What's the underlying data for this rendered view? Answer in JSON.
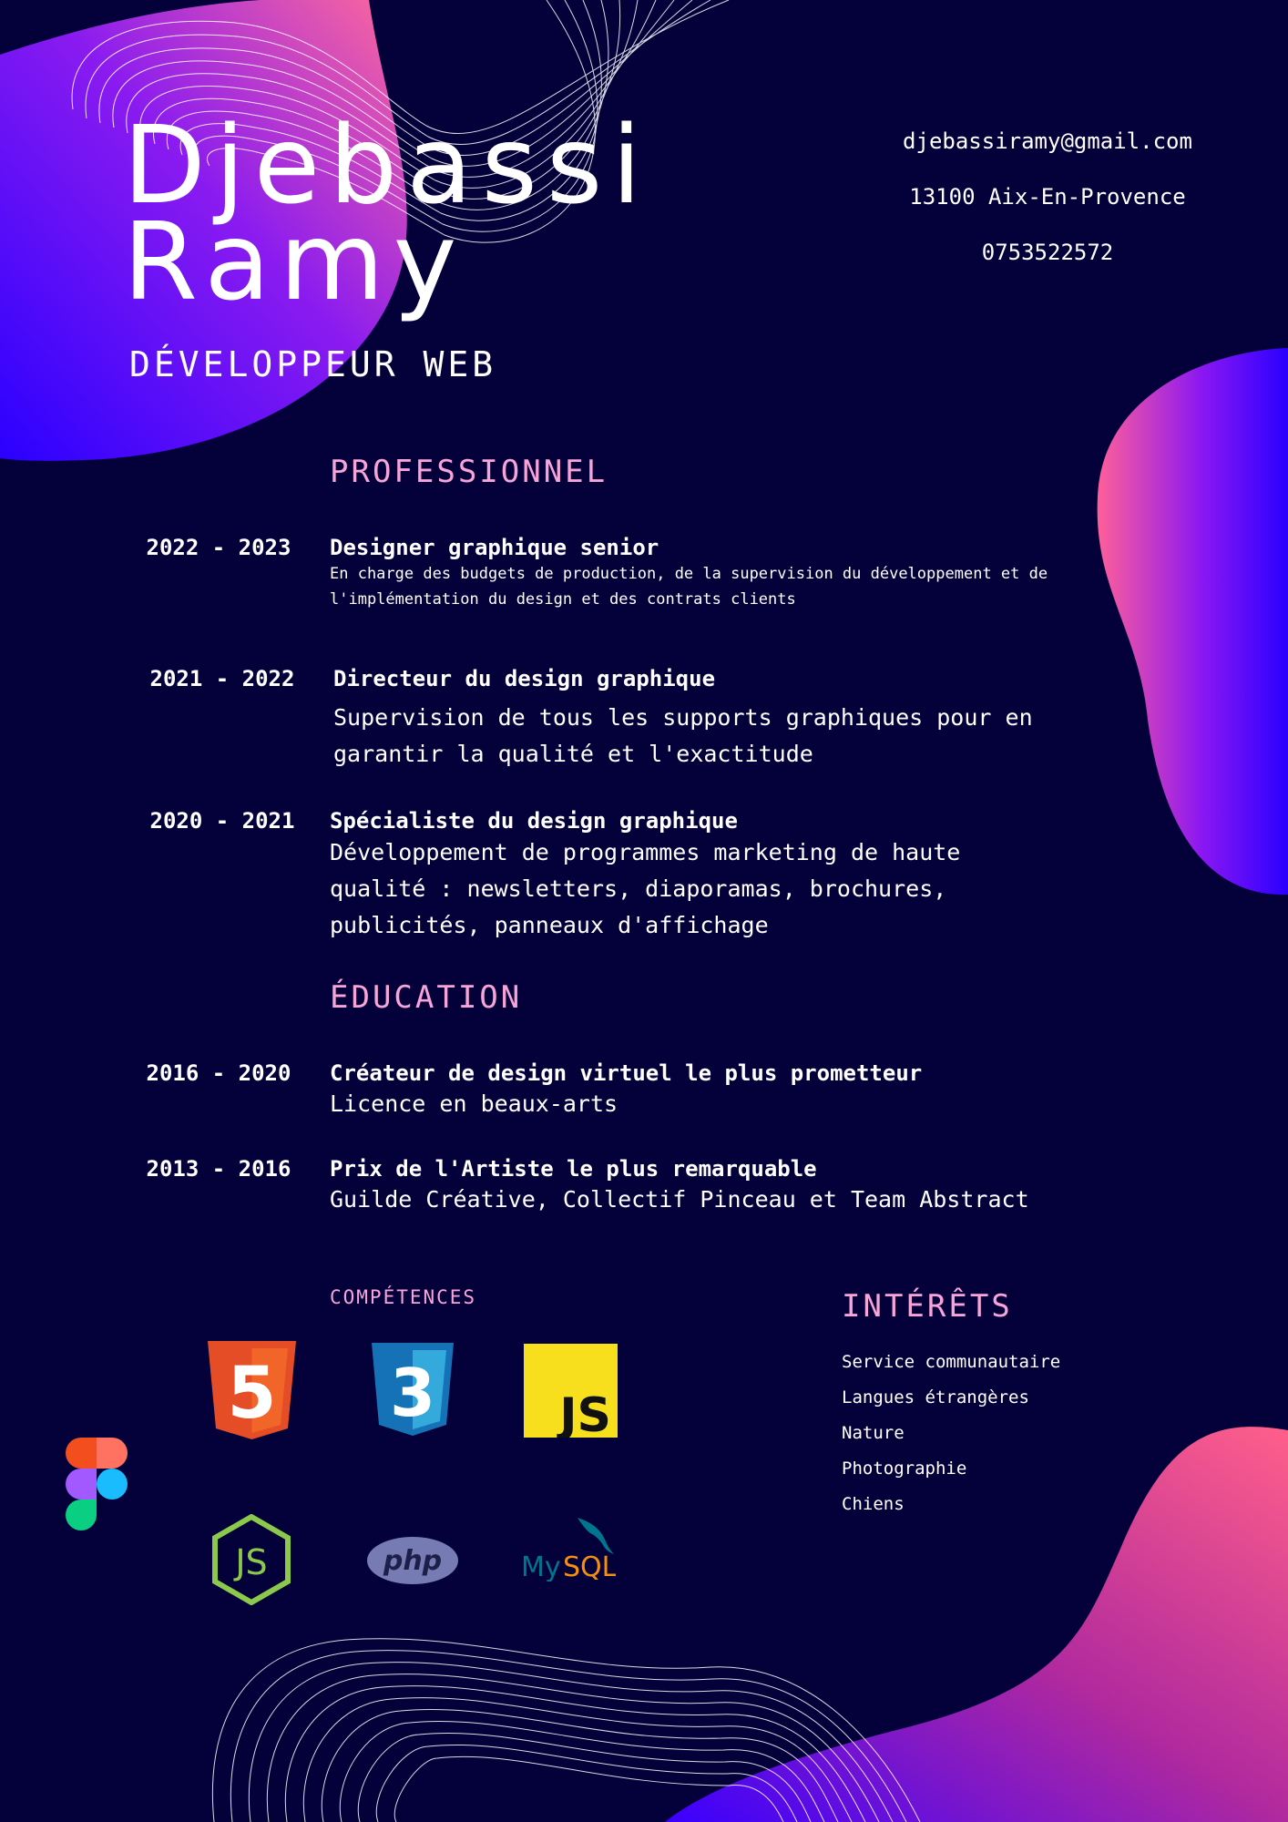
{
  "header": {
    "first_name": "Djebassi",
    "last_name": "Ramy",
    "role": "DÉVELOPPEUR WEB"
  },
  "contact": {
    "email": "djebassiramy@gmail.com",
    "address": "13100 Aix-En-Provence",
    "phone": "0753522572"
  },
  "professionnel": {
    "title": "PROFESSIONNEL",
    "items": [
      {
        "dates": "2022 - 2023",
        "title": "Designer graphique senior",
        "desc": "En charge des budgets de production, de la supervision du développement et de l'implémentation du design et des contrats clients"
      },
      {
        "dates": "2021 - 2022",
        "title": "Directeur du design graphique",
        "desc": "Supervision de tous les supports graphiques pour en garantir la qualité et l'exactitude"
      },
      {
        "dates": "2020 - 2021",
        "title": "Spécialiste du design graphique",
        "desc": "Développement de programmes marketing de haute qualité : newsletters, diaporamas, brochures, publicités, panneaux d'affichage"
      }
    ]
  },
  "education": {
    "title": "ÉDUCATION",
    "items": [
      {
        "dates": "2016 - 2020",
        "title": "Créateur de design virtuel le plus prometteur",
        "desc": "Licence en beaux-arts"
      },
      {
        "dates": "2013 - 2016",
        "title": "Prix de l'Artiste le plus remarquable",
        "desc": "Guilde Créative, Collectif Pinceau et Team Abstract"
      }
    ]
  },
  "competences": {
    "title": "COMPÉTENCES",
    "logos": [
      {
        "icon": "html5-icon",
        "label": "5",
        "color": "#e44d26"
      },
      {
        "icon": "css3-icon",
        "label": "3",
        "color": "#1572b6"
      },
      {
        "icon": "javascript-icon",
        "label": "JS",
        "color": "#f7df1e"
      },
      {
        "icon": "figma-icon",
        "label": ""
      },
      {
        "icon": "nodejs-icon",
        "label": "JS",
        "color": "#8cc84b"
      },
      {
        "icon": "php-icon",
        "label": "php",
        "color": "#777bb3"
      },
      {
        "icon": "mysql-icon",
        "label_my": "My",
        "label_sql": "SQL",
        "color": "#00758f"
      }
    ]
  },
  "interets": {
    "title": "INTÉRÊTS",
    "items": [
      "Service communautaire",
      "Langues étrangères",
      "Nature",
      "Photographie",
      "Chiens"
    ]
  },
  "colors": {
    "background": "#04013a",
    "accent_pink": "#f7a4d8",
    "gradient_blue": "#3a00ff",
    "gradient_pink": "#ff5fa0"
  }
}
